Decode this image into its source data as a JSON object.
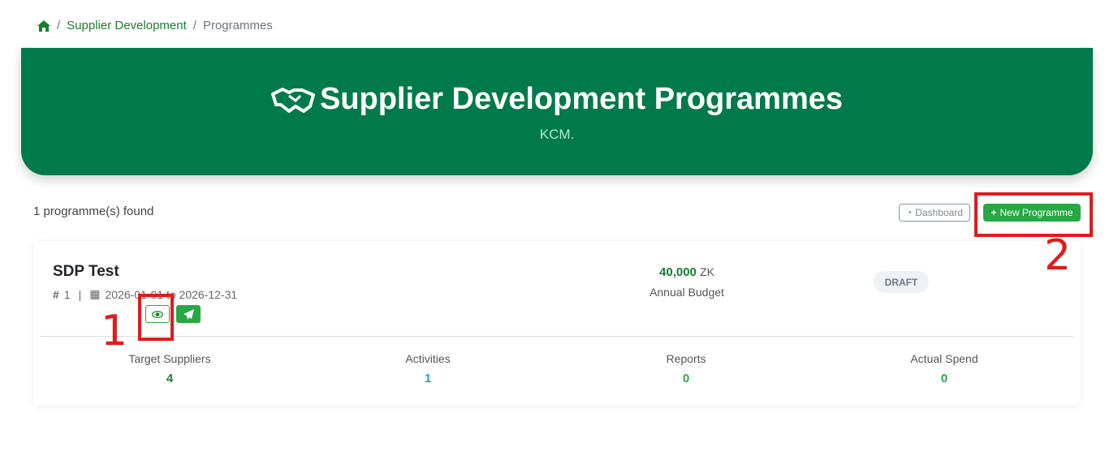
{
  "breadcrumb": {
    "home_icon": "home-icon",
    "items": [
      "Supplier Development",
      "Programmes"
    ]
  },
  "banner": {
    "icon": "handshake-icon",
    "title": "Supplier Development Programmes",
    "subtitle": "KCM."
  },
  "toolbar": {
    "count_text": "1 programme(s) found",
    "dashboard_label": "Dashboard",
    "new_programme_label": "New Programme"
  },
  "programmes": [
    {
      "name": "SDP Test",
      "id_prefix": "#",
      "id": "1",
      "separator": "|",
      "date_range": "2026-01-01 to 2026-12-31",
      "budget_value": "40,000",
      "budget_currency": "ZK",
      "budget_label": "Annual Budget",
      "status": "DRAFT",
      "stats": [
        {
          "label": "Target Suppliers",
          "value": "4",
          "color": "#1a7d2e"
        },
        {
          "label": "Activities",
          "value": "1",
          "color": "#17a2b8"
        },
        {
          "label": "Reports",
          "value": "0",
          "color": "#28a745"
        },
        {
          "label": "Actual Spend",
          "value": "0",
          "color": "#28a745"
        }
      ]
    }
  ],
  "annotations": [
    "1",
    "2"
  ],
  "colors": {
    "brand": "#007a4a",
    "accent": "#28a745",
    "annotation": "#e01b1b"
  }
}
